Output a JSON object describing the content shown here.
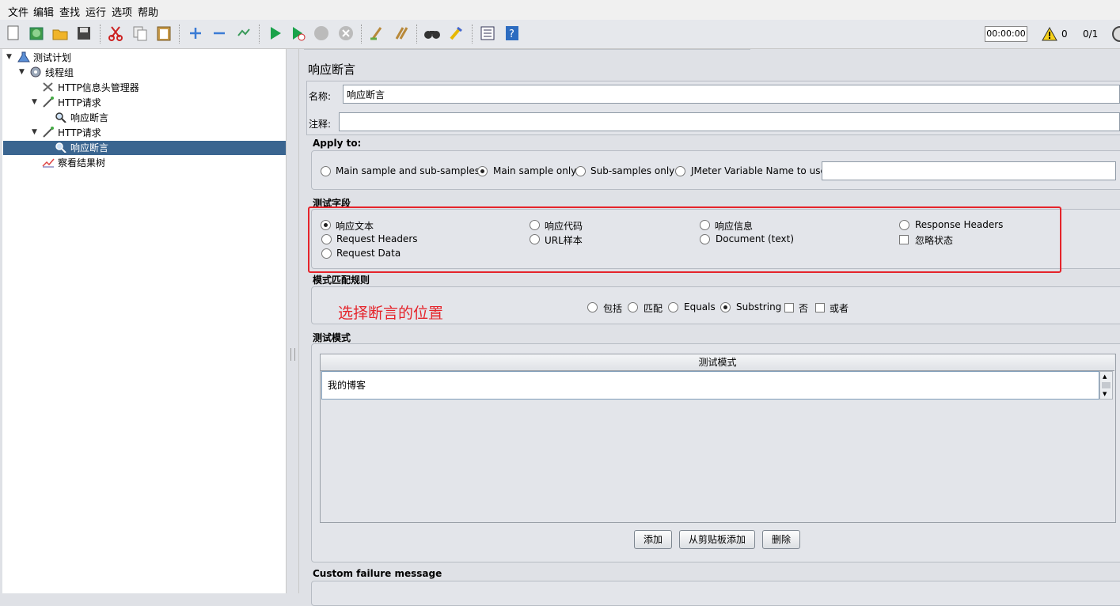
{
  "menu": [
    "文件",
    "编辑",
    "查找",
    "运行",
    "选项",
    "帮助"
  ],
  "toolbar": {
    "timer": "00:00:00",
    "warnings": "0",
    "threads": "0/1",
    "icons": [
      "new-icon",
      "templates-icon",
      "open-icon",
      "save-icon",
      "cut-icon",
      "copy-icon",
      "paste-icon",
      "expand-icon",
      "collapse-icon",
      "toggle-icon",
      "start-icon",
      "start-no-pause-icon",
      "stop-icon",
      "shutdown-icon",
      "clear-icon",
      "clear-all-icon",
      "search-icon",
      "reset-search-icon",
      "function-helper-icon",
      "help-icon"
    ]
  },
  "tree": {
    "nodes": [
      {
        "label": "测试计划",
        "icon": "flask-icon"
      },
      {
        "label": "线程组",
        "icon": "gear-icon"
      },
      {
        "label": "HTTP信息头管理器",
        "icon": "tools-icon"
      },
      {
        "label": "HTTP请求",
        "icon": "pipette-icon"
      },
      {
        "label": "响应断言",
        "icon": "magnifier-icon"
      },
      {
        "label": "HTTP请求",
        "icon": "pipette-icon"
      },
      {
        "label": "响应断言",
        "icon": "magnifier-icon"
      },
      {
        "label": "察看结果树",
        "icon": "chart-icon"
      }
    ]
  },
  "panel": {
    "title": "响应断言",
    "name_label": "名称:",
    "name_value": "响应断言",
    "comment_label": "注释:",
    "comment_value": "",
    "apply_to": {
      "title": "Apply to:",
      "options": [
        "Main sample and sub-samples",
        "Main sample only",
        "Sub-samples only",
        "JMeter Variable Name to use"
      ],
      "selected": "Main sample only",
      "variable_value": ""
    },
    "test_field": {
      "title": "测试字段",
      "options": [
        "响应文本",
        "响应代码",
        "响应信息",
        "Response Headers",
        "Request Headers",
        "URL样本",
        "Document (text)",
        "忽略状态",
        "Request Data"
      ],
      "selected": "响应文本"
    },
    "pattern_rules": {
      "title": "模式匹配规则",
      "options": [
        "包括",
        "匹配",
        "Equals",
        "Substring",
        "否",
        "或者"
      ],
      "selected": "Substring"
    },
    "patterns": {
      "title": "测试模式",
      "column_header": "测试模式",
      "rows": [
        "我的博客"
      ]
    },
    "buttons": {
      "add": "添加",
      "add_clipboard": "从剪贴板添加",
      "delete": "删除"
    },
    "custom_failure": "Custom failure message",
    "annotation": "选择断言的位置"
  },
  "colors": {
    "selection": "#3a6590",
    "annotation": "#e5242b"
  }
}
